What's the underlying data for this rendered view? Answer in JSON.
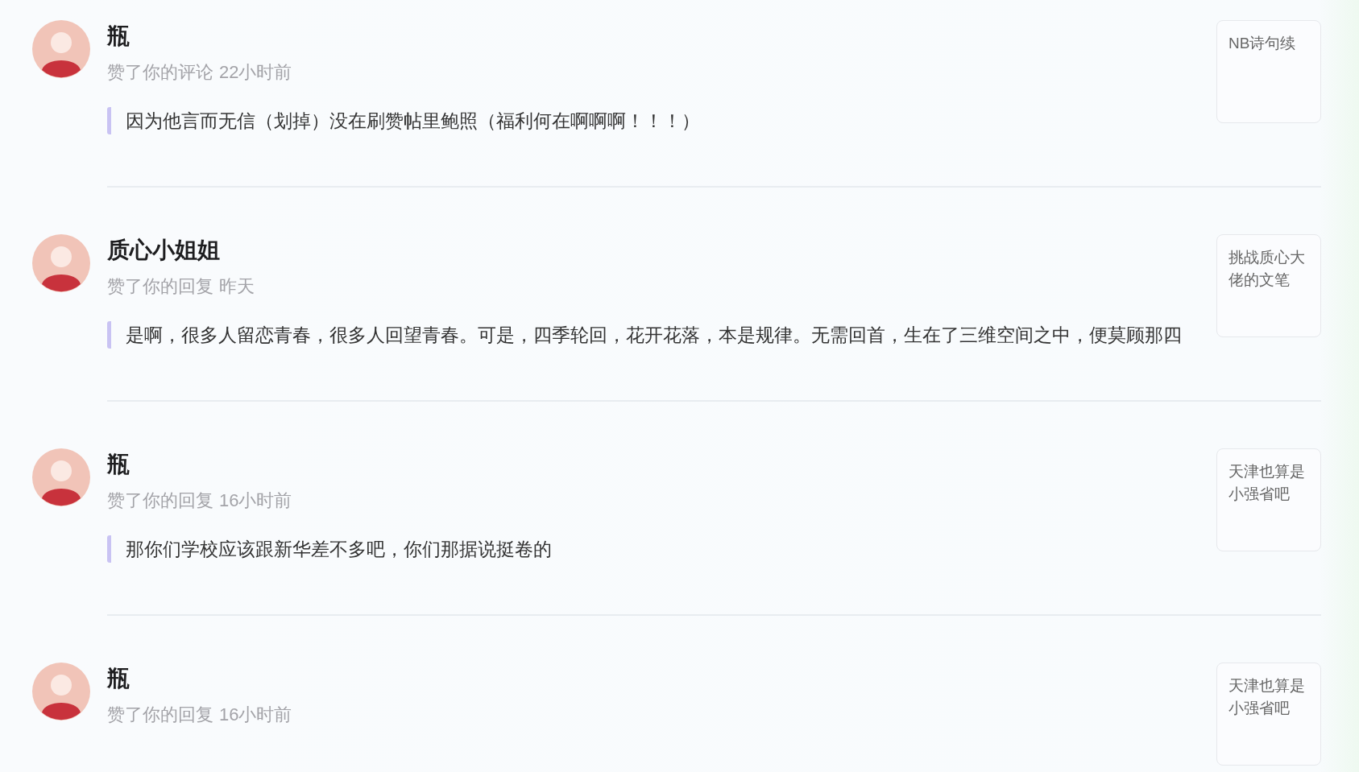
{
  "notifications": [
    {
      "name": "瓶",
      "action": "赞了你的评论",
      "time": "22小时前",
      "comment": "因为他言而无信（划掉）没在刷赞帖里鲍照（福利何在啊啊啊！！！）",
      "quoted": "NB诗句续"
    },
    {
      "name": "质心小姐姐",
      "action": "赞了你的回复",
      "time": "昨天",
      "comment": "是啊，很多人留恋青春，很多人回望青春。可是，四季轮回，花开花落，本是规律。无需回首，生在了三维空间之中，便莫顾那四",
      "quoted": "挑战质心大佬的文笔"
    },
    {
      "name": "瓶",
      "action": "赞了你的回复",
      "time": "16小时前",
      "comment": "那你们学校应该跟新华差不多吧，你们那据说挺卷的",
      "quoted": "天津也算是小强省吧"
    },
    {
      "name": "瓶",
      "action": "赞了你的回复",
      "time": "16小时前",
      "quoted": "天津也算是小强省吧"
    }
  ]
}
